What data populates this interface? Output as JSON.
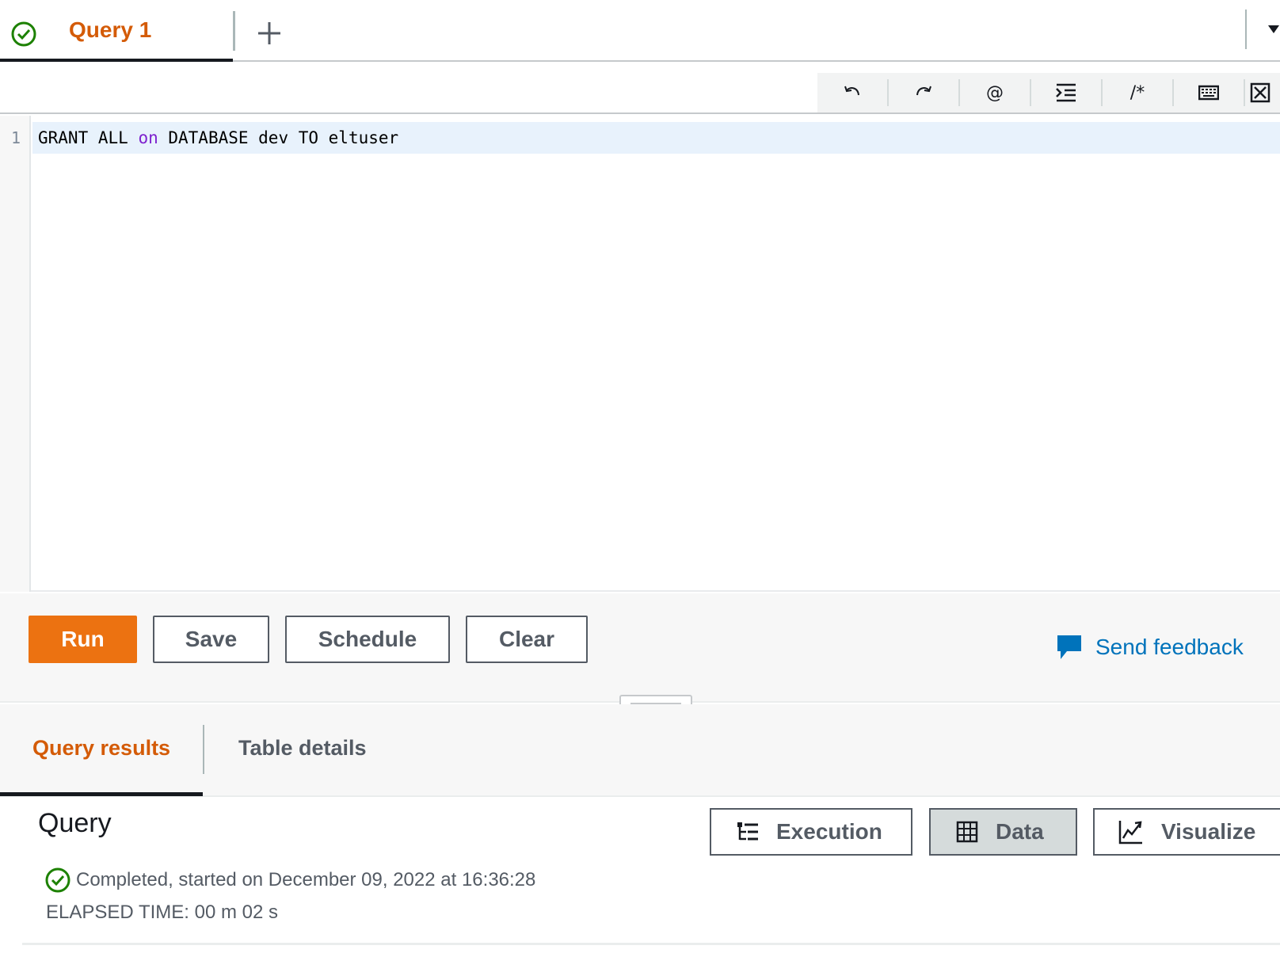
{
  "tab": {
    "title": "Query 1",
    "status": "success"
  },
  "toolbar": {
    "tools": [
      {
        "name": "undo",
        "icon": "undo-icon"
      },
      {
        "name": "redo",
        "icon": "redo-icon"
      },
      {
        "name": "parameter",
        "icon": "at-icon",
        "glyph": "@"
      },
      {
        "name": "format",
        "icon": "format-indent-icon"
      },
      {
        "name": "comment",
        "icon": "comment-icon",
        "glyph": "/*"
      },
      {
        "name": "shortcuts",
        "icon": "keyboard-icon"
      },
      {
        "name": "fullscreen",
        "icon": "expand-icon"
      }
    ]
  },
  "editor": {
    "line_numbers": [
      "1"
    ],
    "code": [
      {
        "text": "GRANT ALL ",
        "kind": "plain"
      },
      {
        "text": "on",
        "kind": "keyword"
      },
      {
        "text": " DATABASE dev TO eltuser",
        "kind": "plain"
      }
    ]
  },
  "actions": {
    "run": "Run",
    "save": "Save",
    "schedule": "Schedule",
    "clear": "Clear",
    "feedback": "Send feedback"
  },
  "result_tabs": {
    "results": "Query results",
    "details": "Table details"
  },
  "results": {
    "title": "Query",
    "views": {
      "execution": "Execution",
      "data": "Data",
      "visualize": "Visualize"
    },
    "selected_view": "Data",
    "status": "Completed, started on December 09, 2022 at 16:36:28",
    "elapsed": "ELAPSED TIME: 00 m 02 s"
  },
  "colors": {
    "accent": "#ec7211",
    "tab_active_text": "#d45b07",
    "link": "#0073bb",
    "success": "#1d8102",
    "keyword": "#7e22ce"
  }
}
